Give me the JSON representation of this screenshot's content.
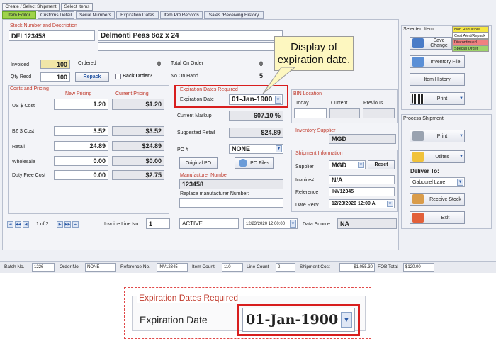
{
  "top_buttons": [
    "Create / Select Shipment",
    "Select Items"
  ],
  "tabs": [
    "Item Editor",
    "Customs Detail",
    "Serial Numbers",
    "Expiration Dates",
    "Item PO Records",
    "Sales /Receiving History"
  ],
  "stock": {
    "title": "Stock Number and Description",
    "number": "DEL123458",
    "description": "Delmonti Peas 8oz x 24"
  },
  "counts": {
    "invoiced_label": "Invoiced",
    "invoiced": "100",
    "ordered_label": "Ordered",
    "ordered": "0",
    "total_on_order_label": "Total On Order",
    "total_on_order": "0",
    "qty_recd_label": "Qty Recd",
    "qty_recd": "100",
    "repack_label": "Repack",
    "back_order_label": "Back Order?",
    "no_on_hand_label": "No On Hand",
    "no_on_hand": "5"
  },
  "costs": {
    "title": "Costs and Pricing",
    "new_pricing_label": "New Pricing",
    "current_pricing_label": "Current Pricing",
    "rows": [
      {
        "label": "US $ Cost",
        "new": "1.20",
        "current": "$1.20"
      },
      {
        "label": "BZ $ Cost",
        "new": "3.52",
        "current": "$3.52"
      },
      {
        "label": "Retail",
        "new": "24.89",
        "current": "$24.89"
      },
      {
        "label": "Wholesale",
        "new": "0.00",
        "current": "$0.00"
      },
      {
        "label": "Duty Free Cost",
        "new": "0.00",
        "current": "$2.75"
      }
    ]
  },
  "expiration": {
    "title": "Expiration Dates Required",
    "label": "Expiration Date",
    "value": "01-Jan-1900"
  },
  "markup": {
    "current_markup_label": "Current Markup",
    "current_markup": "607.10 %",
    "suggested_retail_label": "Suggested Retail",
    "suggested_retail": "$24.89",
    "po_label": "PO #",
    "po_value": "NONE",
    "original_po_label": "Original PO",
    "po_files_label": "PO Files"
  },
  "manufacturer": {
    "title": "Manufacturer Number",
    "number": "123458",
    "replace_label": "Replace manufacturer Number:"
  },
  "bin_location": {
    "title": "BIN Location",
    "today": "Today",
    "current": "Current",
    "previous": "Previous"
  },
  "inventory_supplier": {
    "title": "Inventory Supplier",
    "value": "MGD"
  },
  "shipment_info": {
    "title": "Shipment Information",
    "supplier_label": "Supplier",
    "supplier": "MGD",
    "reset_label": "Reset",
    "invoice_label": "Invoice#",
    "invoice": "N/A",
    "reference_label": "Reference",
    "reference": "INV12345",
    "date_recv_label": "Date Recv",
    "date_recv": "12/23/2020 12:00 A"
  },
  "navigator": {
    "position": "1 of 2",
    "invoice_line_label": "Invoice Line No.",
    "invoice_line": "1"
  },
  "footer_fields": {
    "status": "ACTIVE",
    "date": "12/23/2020 12:00:00",
    "data_source_label": "Data Source",
    "data_source": "NA"
  },
  "selected_item": {
    "title": "Selected Item",
    "legend": [
      {
        "label": "Non Reducible",
        "color": "#f5e642"
      },
      {
        "label": "Cost Alert/Repack",
        "color": "#ffffff"
      },
      {
        "label": "Discontinued",
        "color": "#f08080"
      },
      {
        "label": "Special Order",
        "color": "#9ed36a"
      }
    ],
    "buttons": [
      "Save Change",
      "Inventory File",
      "Item History",
      "Print"
    ]
  },
  "process_shipment": {
    "title": "Process Shipment",
    "print_label": "Print",
    "utilities_label": "Utlites",
    "deliver_to_label": "Deliver To:",
    "deliver_to_value": "Gabourel Lane",
    "receive_stock_label": "Receive Stock",
    "exit_label": "Exit"
  },
  "status_bar": [
    {
      "label": "Batch No.",
      "value": "1226"
    },
    {
      "label": "Order No.",
      "value": "NONE"
    },
    {
      "label": "Reference No.",
      "value": "INV12345"
    },
    {
      "label": "Item Count",
      "value": "110"
    },
    {
      "label": "Line Count",
      "value": "2"
    },
    {
      "label": "Shipment Cost",
      "value": "$1,055.30"
    },
    {
      "label": "FOB Total",
      "value": "$120.00"
    }
  ],
  "callout": {
    "text": "Display of expiration date."
  },
  "zoom": {
    "title": "Expiration Dates Required",
    "label": "Expiration Date",
    "value": "01-Jan-1900"
  },
  "colors": {
    "accent_tab": "#9fd34a",
    "highlight": "#d81e1e",
    "callout_bg": "#fdf7c0"
  }
}
